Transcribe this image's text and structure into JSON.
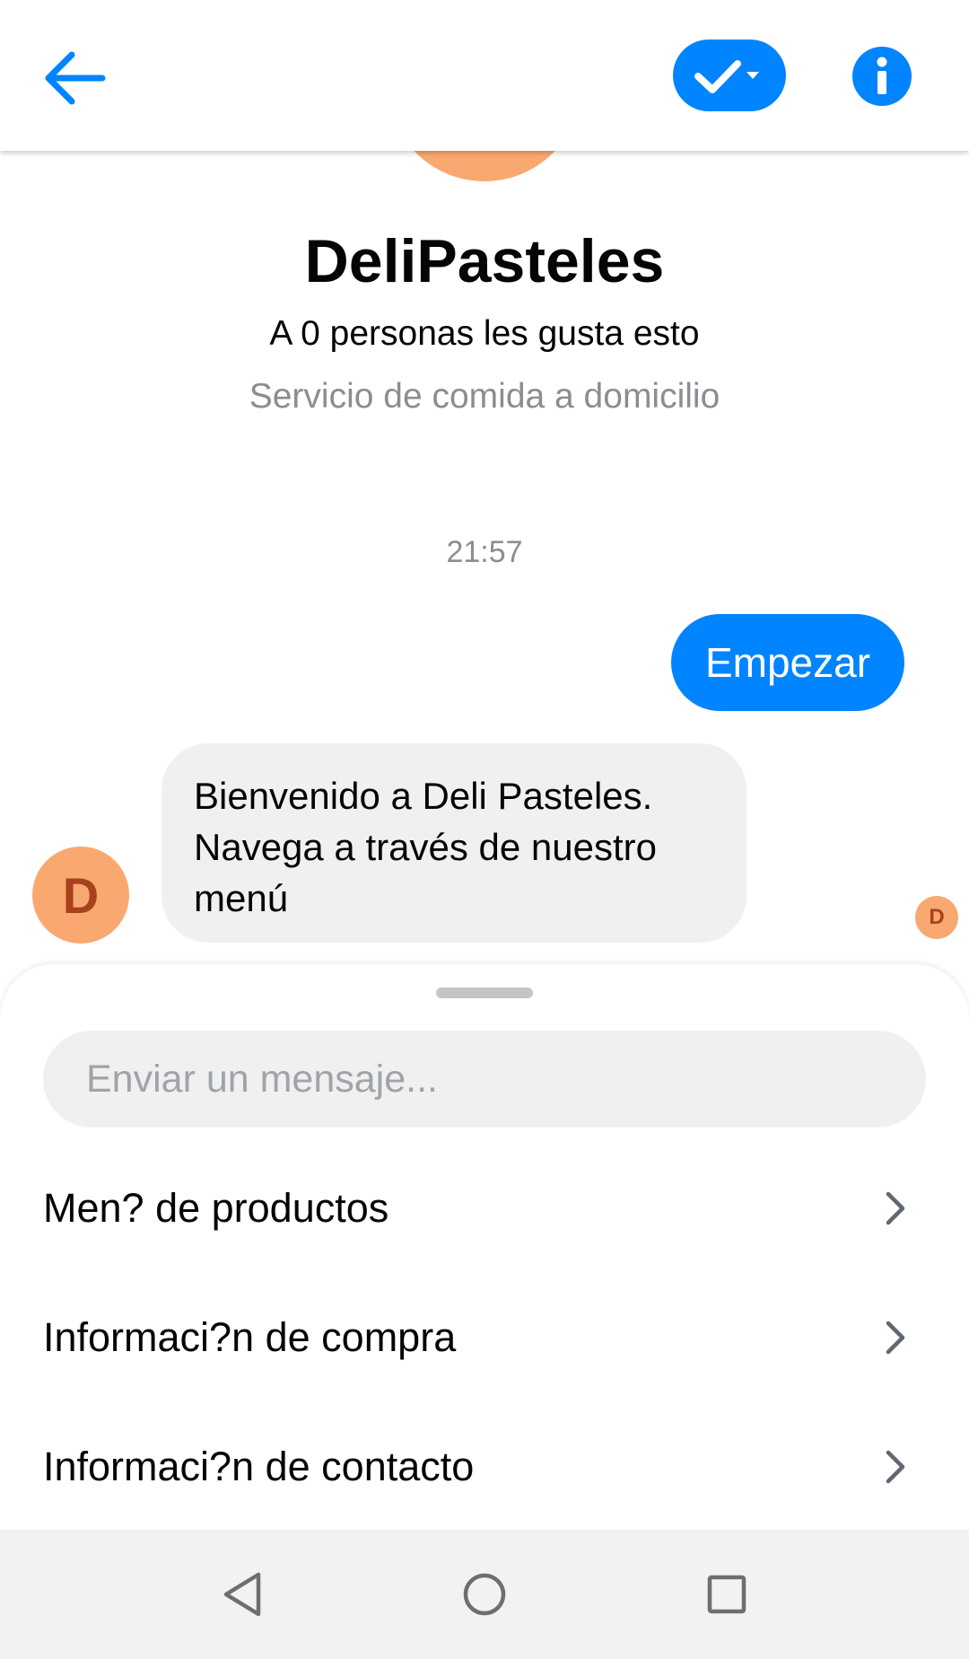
{
  "header": {
    "back_icon": "arrow-left-icon",
    "done_icon": "checkmark-dropdown-icon",
    "info_icon": "info-icon",
    "accent_color": "#0084ff"
  },
  "profile": {
    "name": "DeliPasteles",
    "likes": "A 0 personas les gusta esto",
    "category": "Servicio de comida a domicilio",
    "avatar_color": "#f9a870"
  },
  "conversation": {
    "timestamp": "21:57",
    "sent_message": "Empezar",
    "bot_avatar_letter": "D",
    "received_message": "Bienvenido a Deli Pasteles. Navega a través de nuestro menú",
    "read_receipt_letter": "D"
  },
  "composer": {
    "placeholder": "Enviar un mensaje..."
  },
  "quick_replies": [
    {
      "label": "Men? de productos"
    },
    {
      "label": "Informaci?n de compra"
    },
    {
      "label": "Informaci?n de contacto"
    }
  ],
  "navbar": {
    "back_icon": "triangle-back-icon",
    "home_icon": "circle-home-icon",
    "recents_icon": "square-recents-icon"
  }
}
